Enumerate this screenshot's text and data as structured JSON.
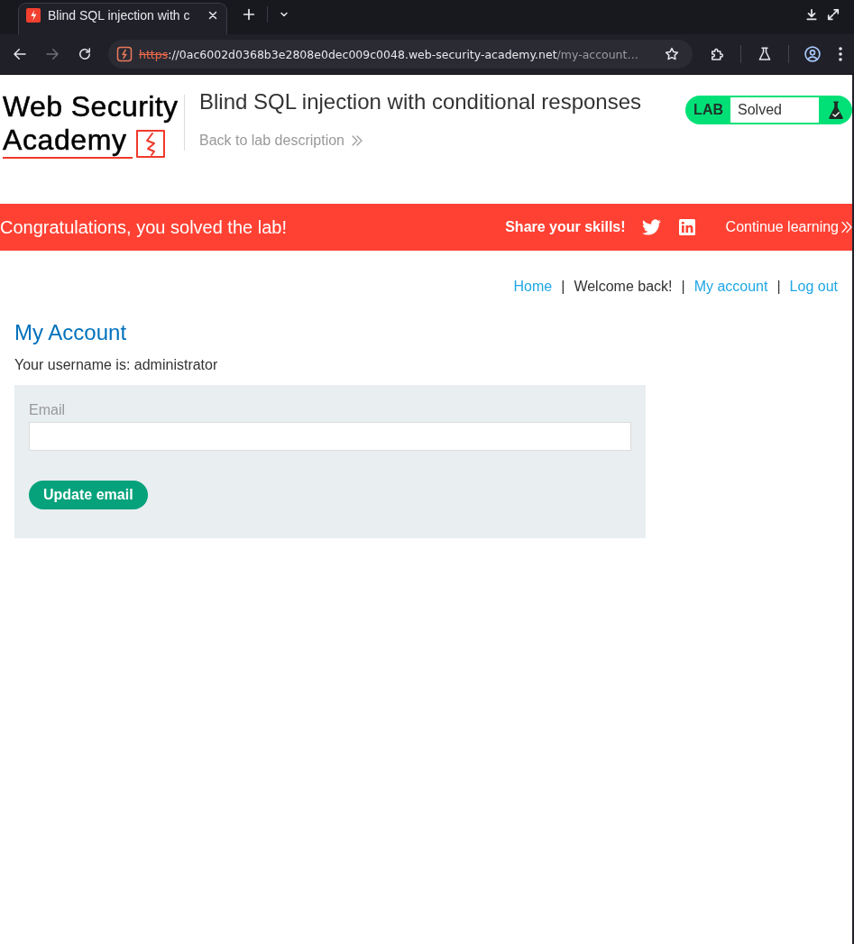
{
  "browser": {
    "tabs": [
      {
        "title": "Blind SQL injection with c",
        "selected": true
      }
    ],
    "toolbar_buttons": [
      {
        "kind": "back",
        "disabled": false
      },
      {
        "kind": "forward",
        "disabled": true
      },
      {
        "kind": "reload",
        "disabled": false
      }
    ],
    "address": {
      "scheme": "https",
      "rest": "://0ac6002d0368b3e2808e0dec009c0048.web-security-academy.net",
      "path": "/my-account…",
      "secure": false
    }
  },
  "header": {
    "logo": [
      "Web Security",
      "Academy"
    ],
    "title": "Blind SQL injection with conditional responses",
    "back_link": "Back to lab description",
    "lab_status": {
      "label": "LAB",
      "status": "Solved",
      "solved": true
    }
  },
  "banner": {
    "message": "Congratulations, you solved the lab!",
    "share_label": "Share your skills!",
    "continue_link": "Continue learning"
  },
  "nav": [
    {
      "kind": "link",
      "label": "Home"
    },
    {
      "kind": "separator",
      "label": "|"
    },
    {
      "kind": "text",
      "label": "Welcome back!"
    },
    {
      "kind": "separator",
      "label": "|"
    },
    {
      "kind": "link",
      "label": "My account"
    },
    {
      "kind": "separator",
      "label": "|"
    },
    {
      "kind": "link",
      "label": "Log out"
    }
  ],
  "account": {
    "heading": "My Account",
    "username_text": "Your username is: administrator",
    "form": {
      "email_label": "Email",
      "submit": "Update email"
    }
  }
}
